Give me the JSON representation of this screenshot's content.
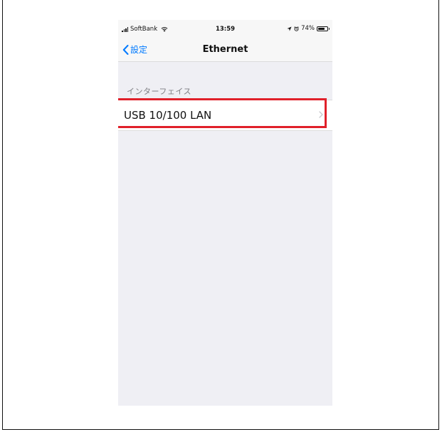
{
  "status_bar": {
    "carrier": "SoftBank",
    "time": "13:59",
    "battery_percent": "74%",
    "battery_level": 0.74
  },
  "nav": {
    "back_label": "設定",
    "title": "Ethernet"
  },
  "section": {
    "header": "インターフェイス",
    "items": [
      {
        "label": "USB 10/100 LAN"
      }
    ]
  },
  "colors": {
    "accent": "#007aff",
    "highlight": "#e0202a",
    "background": "#efeff4"
  },
  "icons": {
    "signal": "signal-bars-icon",
    "wifi": "wifi-icon",
    "location": "location-arrow-icon",
    "alarm": "alarm-icon",
    "battery": "battery-icon",
    "back": "chevron-left-icon",
    "disclosure": "chevron-right-icon"
  }
}
